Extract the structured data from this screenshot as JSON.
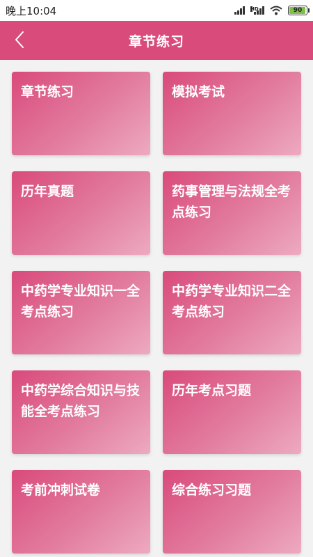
{
  "status_bar": {
    "time": "晚上10:04",
    "battery": "90",
    "network_label": "HD",
    "icons": [
      "signal-icon",
      "signal-icon",
      "wifi-icon",
      "battery-icon"
    ]
  },
  "header": {
    "title": "章节练习",
    "back_icon": "chevron-left-icon"
  },
  "colors": {
    "accent": "#d84b7a",
    "card_start": "#d94a7b",
    "card_end": "#edaac0",
    "background": "#f2f2f2"
  },
  "cards": [
    {
      "label": "章节练习"
    },
    {
      "label": "模拟考试"
    },
    {
      "label": "历年真题"
    },
    {
      "label": "药事管理与法规全考点练习"
    },
    {
      "label": "中药学专业知识一全考点练习"
    },
    {
      "label": "中药学专业知识二全考点练习"
    },
    {
      "label": "中药学综合知识与技能全考点练习"
    },
    {
      "label": "历年考点习题"
    },
    {
      "label": "考前冲刺试卷"
    },
    {
      "label": "综合练习习题"
    }
  ]
}
